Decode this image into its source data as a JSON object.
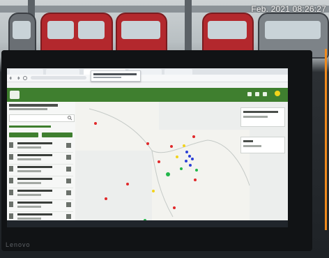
{
  "overlay": {
    "timestamp": "Feb. 2021 08:26:27"
  },
  "monitor": {
    "brand": "Lenovo"
  },
  "colors": {
    "header_green": "#3f7f2f",
    "dot_red": "#e0282a",
    "dot_blue": "#2b3fd6",
    "dot_green": "#22b64a",
    "dot_yellow": "#f2d31b"
  },
  "icons": {
    "header": [
      "logo-icon",
      "grid-icon",
      "info-icon",
      "settings-icon"
    ],
    "browser": [
      "back-icon",
      "forward-icon",
      "reload-icon"
    ]
  }
}
